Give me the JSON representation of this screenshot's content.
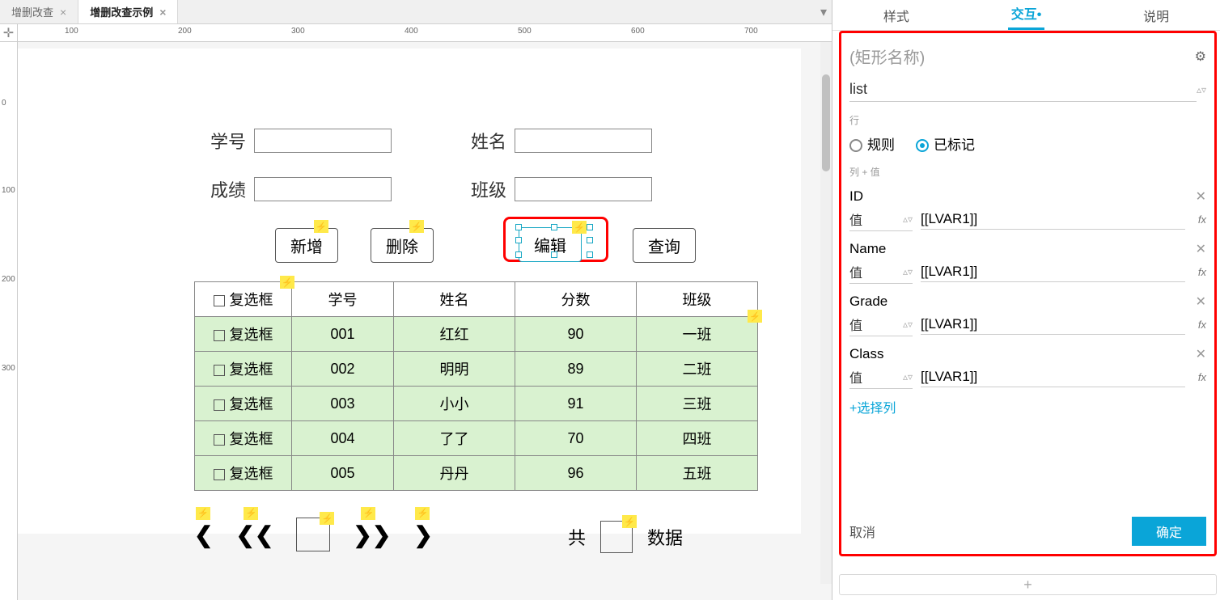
{
  "tabs": [
    {
      "label": "增删改查",
      "active": false
    },
    {
      "label": "增删改查示例",
      "active": true
    }
  ],
  "ruler_h": [
    "100",
    "200",
    "300",
    "400",
    "500",
    "600",
    "700"
  ],
  "ruler_v": [
    "0",
    "100",
    "200",
    "300"
  ],
  "form": {
    "id_label": "学号",
    "name_label": "姓名",
    "grade_label": "成绩",
    "class_label": "班级"
  },
  "buttons": {
    "add": "新增",
    "delete": "删除",
    "edit": "编辑",
    "query": "查询"
  },
  "table": {
    "headers": [
      "复选框",
      "学号",
      "姓名",
      "分数",
      "班级"
    ],
    "checkbox_label": "复选框",
    "rows": [
      [
        "001",
        "红红",
        "90",
        "一班"
      ],
      [
        "002",
        "明明",
        "89",
        "二班"
      ],
      [
        "003",
        "小小",
        "91",
        "三班"
      ],
      [
        "004",
        "了了",
        "70",
        "四班"
      ],
      [
        "005",
        "丹丹",
        "96",
        "五班"
      ]
    ]
  },
  "pager": {
    "total_label_left": "共",
    "total_label_right": "数据"
  },
  "right_panel": {
    "tabs": {
      "style": "样式",
      "interact": "交互",
      "notes": "说明"
    },
    "shape_name_placeholder": "(矩形名称)",
    "target": "list",
    "row_section": "行",
    "radio_rule": "规则",
    "radio_marked": "已标记",
    "col_section": "列 + 值",
    "value_label": "值",
    "columns": [
      {
        "name": "ID",
        "value": "[[LVAR1]]"
      },
      {
        "name": "Name",
        "value": "[[LVAR1]]"
      },
      {
        "name": "Grade",
        "value": "[[LVAR1]]"
      },
      {
        "name": "Class",
        "value": "[[LVAR1]]"
      }
    ],
    "add_column": "+选择列",
    "cancel": "取消",
    "ok": "确定"
  }
}
